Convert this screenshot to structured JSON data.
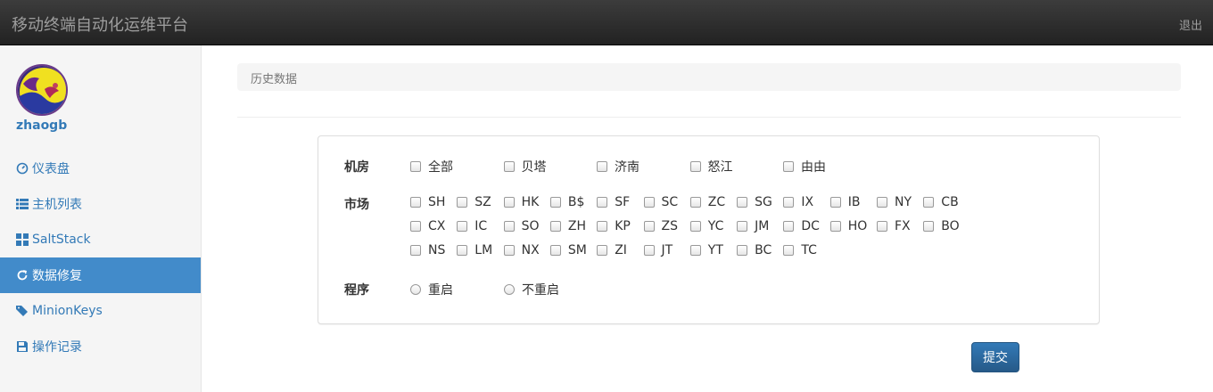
{
  "header": {
    "title": "移动终端自动化运维平台",
    "logout": "退出"
  },
  "user": {
    "name": "zhaogb"
  },
  "sidebar": {
    "items": [
      {
        "label": "仪表盘",
        "icon": "dashboard-icon"
      },
      {
        "label": "主机列表",
        "icon": "list-icon"
      },
      {
        "label": "SaltStack",
        "icon": "grid-icon"
      },
      {
        "label": "数据修复",
        "icon": "refresh-icon",
        "active": true
      },
      {
        "label": "MinionKeys",
        "icon": "tags-icon"
      },
      {
        "label": "操作记录",
        "icon": "floppy-icon"
      }
    ]
  },
  "breadcrumb": "历史数据",
  "form": {
    "room": {
      "label": "机房",
      "options": [
        "全部",
        "贝塔",
        "济南",
        "怒江",
        "由由"
      ]
    },
    "market": {
      "label": "市场",
      "options": [
        "SH",
        "SZ",
        "HK",
        "B$",
        "SF",
        "SC",
        "ZC",
        "SG",
        "IX",
        "IB",
        "NY",
        "CB",
        "CX",
        "IC",
        "SO",
        "ZH",
        "KP",
        "ZS",
        "YC",
        "JM",
        "DC",
        "HO",
        "FX",
        "BO",
        "NS",
        "LM",
        "NX",
        "SM",
        "ZI",
        "JT",
        "YT",
        "BC",
        "TC"
      ]
    },
    "program": {
      "label": "程序",
      "options": [
        "重启",
        "不重启"
      ]
    },
    "submit": "提交"
  }
}
